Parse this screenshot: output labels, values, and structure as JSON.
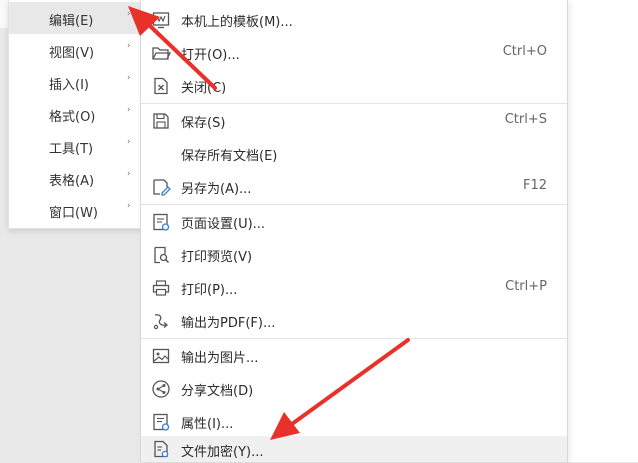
{
  "left_menu": {
    "items": [
      {
        "label": "编辑(E)",
        "arrow": "›"
      },
      {
        "label": "视图(V)",
        "arrow": "›"
      },
      {
        "label": "插入(I)",
        "arrow": "›"
      },
      {
        "label": "格式(O)",
        "arrow": "›"
      },
      {
        "label": "工具(T)",
        "arrow": "›"
      },
      {
        "label": "表格(A)",
        "arrow": "›"
      },
      {
        "label": "窗口(W)",
        "arrow": "›"
      }
    ]
  },
  "file_menu": {
    "items": [
      {
        "label": "本机上的模板(M)...",
        "shortcut": "",
        "icon": "template-icon"
      },
      {
        "label": "打开(O)...",
        "shortcut": "Ctrl+O",
        "icon": "folder-open-icon"
      },
      {
        "label": "关闭(C)",
        "shortcut": "",
        "icon": "close-doc-icon"
      },
      {
        "label": "保存(S)",
        "shortcut": "Ctrl+S",
        "icon": "save-icon"
      },
      {
        "label": "保存所有文档(E)",
        "shortcut": "",
        "icon": ""
      },
      {
        "label": "另存为(A)...",
        "shortcut": "F12",
        "icon": "save-as-icon"
      },
      {
        "label": "页面设置(U)...",
        "shortcut": "",
        "icon": "page-setup-icon"
      },
      {
        "label": "打印预览(V)",
        "shortcut": "",
        "icon": "print-preview-icon"
      },
      {
        "label": "打印(P)...",
        "shortcut": "Ctrl+P",
        "icon": "printer-icon"
      },
      {
        "label": "输出为PDF(F)...",
        "shortcut": "",
        "icon": "export-pdf-icon"
      },
      {
        "label": "输出为图片...",
        "shortcut": "",
        "icon": "export-image-icon"
      },
      {
        "label": "分享文档(D)",
        "shortcut": "",
        "icon": "share-icon"
      },
      {
        "label": "属性(I)...",
        "shortcut": "",
        "icon": "properties-icon"
      },
      {
        "label": "文件加密(Y)...",
        "shortcut": "",
        "icon": "encrypt-file-icon"
      }
    ]
  },
  "annotation_color": "#e8312a"
}
